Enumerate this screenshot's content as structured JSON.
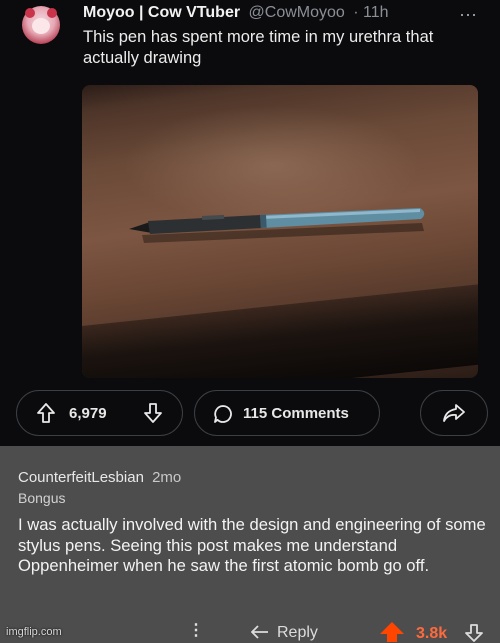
{
  "tweet": {
    "display_name": "Moyoo | Cow VTuber",
    "handle": "@CowMoyoo",
    "age": "· 11h",
    "more_icon": "more-horizontal-icon",
    "text": "This pen has spent more time in my urethra that actually drawing"
  },
  "post_actions": {
    "upvote_icon": "upvote-arrow-icon",
    "vote_count": "6,979",
    "downvote_icon": "downvote-arrow-icon",
    "comments_icon": "comment-bubble-icon",
    "comments_label": "115 Comments",
    "share_icon": "share-arrow-icon"
  },
  "comment": {
    "username": "CounterfeitLesbian",
    "age": "2mo",
    "flair": "Bongus",
    "body": "I was actually involved with the design and engineering of some stylus pens. Seeing this post makes me understand Oppenheimer when he saw the first atomic bomb go off.",
    "reply_label": "Reply",
    "score": "3.8k"
  },
  "colors": {
    "background_top": "#0b0b0d",
    "background_comment": "#4d4d4d",
    "upvote_accent": "#ff4500"
  },
  "watermark": "imgflip.com"
}
